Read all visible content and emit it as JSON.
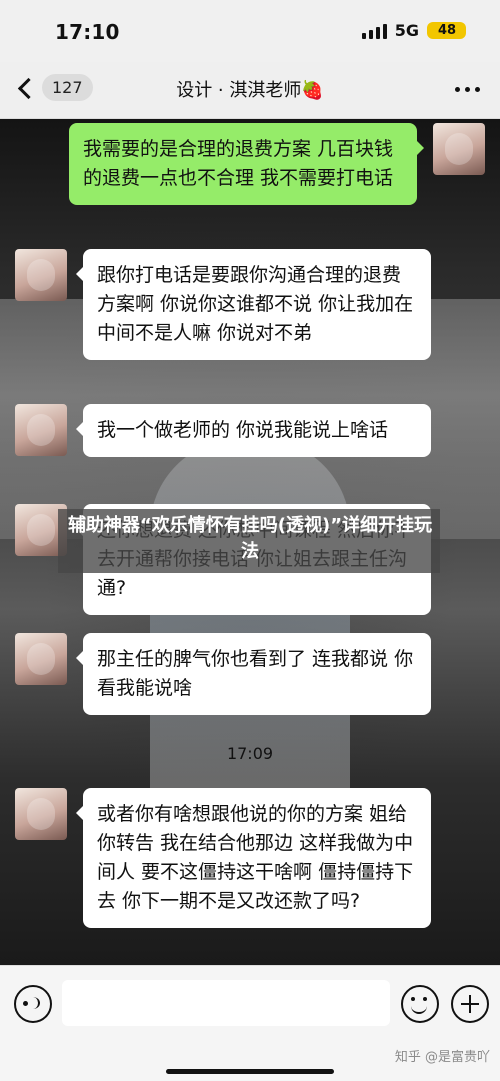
{
  "status_bar": {
    "time": "17:10",
    "network": "5G",
    "battery": "48"
  },
  "nav": {
    "unread_count": "127",
    "title": "设计 · 淇淇老师🍓"
  },
  "chat": {
    "messages": [
      {
        "side": "out",
        "text": "我需要的是合理的退费方案 几百块钱的退费一点也不合理 我不需要打电话"
      },
      {
        "side": "in",
        "text": "跟你打电话是要跟你沟通合理的退费方案啊 你说你这谁都不说 你让我加在中间不是人嘛 你说对不弟"
      },
      {
        "side": "in",
        "text": "我一个做老师的  你说我能说上啥话"
      },
      {
        "side": "in",
        "text": "还你想退费 还你想中间课程 然后你不去开通帮你接电话 你让姐去跟主任沟通?"
      },
      {
        "side": "in",
        "text": "那主任的脾气你也看到了 连我都说  你看我能说啥"
      },
      {
        "side": "in",
        "text": "或者你有啥想跟他说的你的方案 姐给你转告 我在结合他那边 这样我做为中间人 要不这僵持这干啥啊 僵持僵持下去 你下一期不是又改还款了吗?"
      }
    ],
    "time_divider": "17:09"
  },
  "overlay": {
    "caption": "辅助神器“欢乐情怀有挂吗(透视)”详细开挂玩法"
  },
  "input": {
    "placeholder": ""
  },
  "watermark": "知乎 @是富贵吖"
}
